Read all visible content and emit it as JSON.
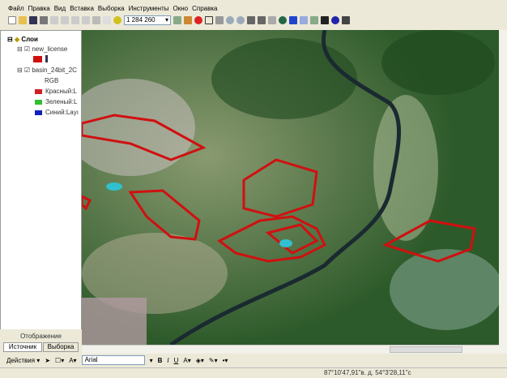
{
  "menu": [
    "Файл",
    "Правка",
    "Вид",
    "Вставка",
    "Выборка",
    "Инструменты",
    "Окно",
    "Справка"
  ],
  "toolbar": {
    "scale": "1 284 260"
  },
  "toc": {
    "root": "Слои",
    "layers": [
      {
        "name": "new_license"
      },
      {
        "name": "basin_24bit_2C",
        "rgb": "RGB",
        "bands": [
          {
            "label": "Красный:L",
            "color": "#d22020"
          },
          {
            "label": "Зеленый:L",
            "color": "#30c030"
          },
          {
            "label": "Синий:Layı",
            "color": "#1020c0"
          }
        ]
      }
    ],
    "tabs": {
      "display": "Отображение",
      "source": "Источник",
      "selection": "Выборка"
    }
  },
  "drawing": {
    "actions": "Действия",
    "font": "Arial"
  },
  "status": {
    "coords": "87°10'47,91\"в. д.  54°3'28,11\"с"
  },
  "colors": {
    "polygon": "#d01010"
  }
}
